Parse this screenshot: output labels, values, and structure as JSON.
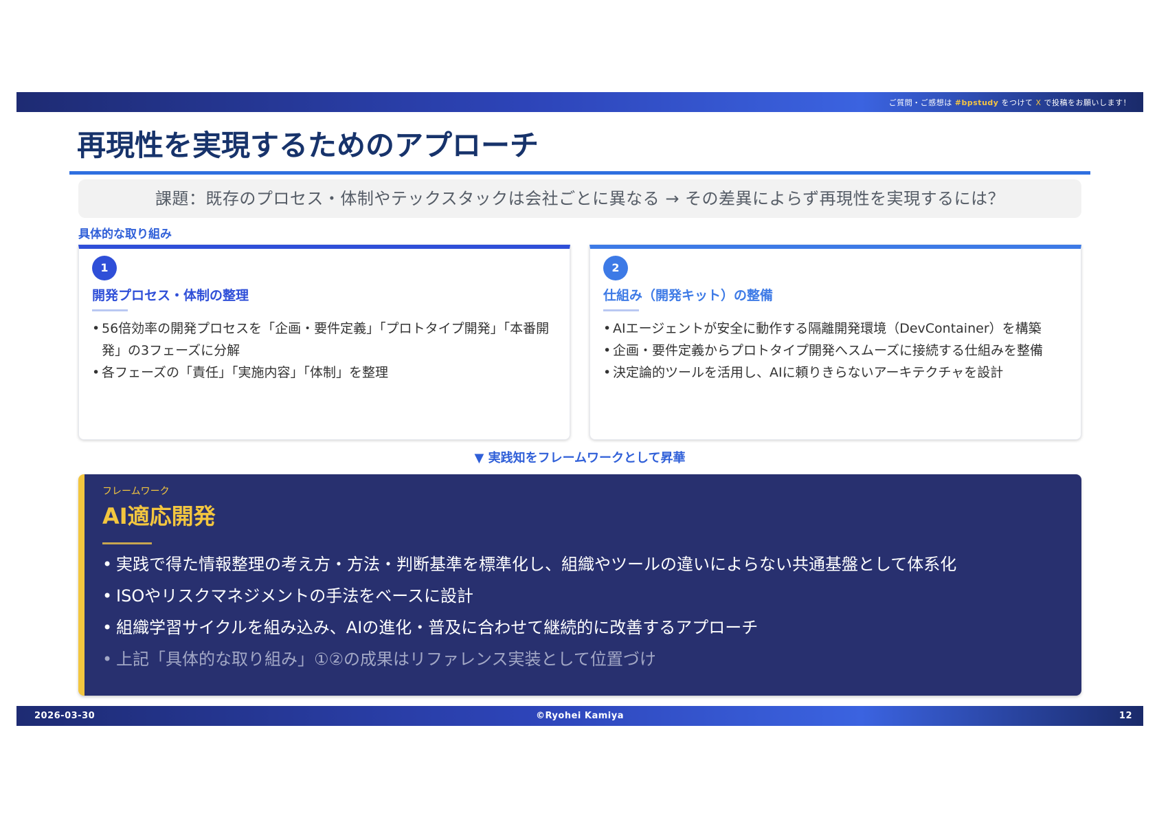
{
  "header": {
    "notice_prefix": "ご質問・ご感想は",
    "notice_hashtag": "#bpstudy",
    "notice_middle": "をつけて",
    "notice_x": "X",
    "notice_suffix": "で投稿をお願いします！"
  },
  "title": "再現性を実現するためのアプローチ",
  "issue": "課題：既存のプロセス・体制やテックスタックは会社ごとに異なる → その差異によらず再現性を実現するには？",
  "section_label": "具体的な取り組み",
  "cards": [
    {
      "number": "1",
      "title": "開発プロセス・体制の整理",
      "bullets": [
        "56倍効率の開発プロセスを「企画・要件定義」「プロトタイプ開発」「本番開発」の3フェーズに分解",
        "各フェーズの「責任」「実施内容」「体制」を整理"
      ]
    },
    {
      "number": "2",
      "title": "仕組み（開発キット）の整備",
      "bullets": [
        "AIエージェントが安全に動作する隔離開発環境（DevContainer）を構築",
        "企画・要件定義からプロトタイプ開発へスムーズに接続する仕組みを整備",
        "決定論的ツールを活用し、AIに頼りきらないアーキテクチャを設計"
      ]
    }
  ],
  "arrow_text": "▼ 実践知をフレームワークとして昇華",
  "framework": {
    "label": "フレームワーク",
    "title": "AI適応開発",
    "bullets": [
      "実践で得た情報整理の考え方・方法・判断基準を標準化し、組織やツールの違いによらない共通基盤として体系化",
      "ISOやリスクマネジメントの手法をベースに設計",
      "組織学習サイクルを組み込み、AIの進化・普及に合わせて継続的に改善するアプローチ",
      "上記「具体的な取り組み」①②の成果はリファレンス実装として位置づけ"
    ]
  },
  "footer": {
    "date": "2026-03-30",
    "copyright": "©Ryohei Kamiya",
    "page": "12"
  },
  "colors": {
    "title": "#17336b",
    "accent_blue": "#2f5fd8",
    "card2_blue": "#3d7ae6",
    "framework_bg": "#28306f",
    "framework_yellow": "#f3c63f"
  }
}
